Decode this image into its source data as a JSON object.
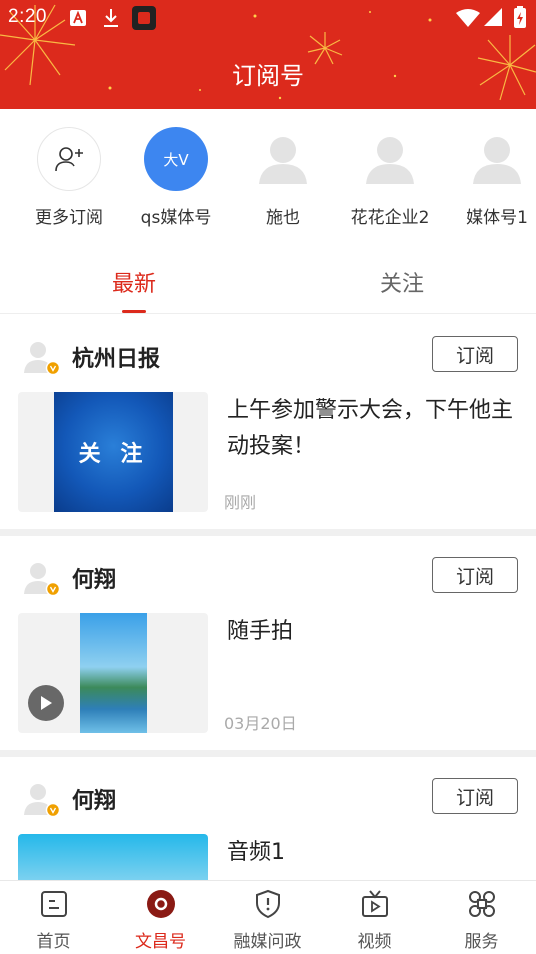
{
  "status_bar": {
    "time": "2:20"
  },
  "header": {
    "title": "订阅号"
  },
  "subscriptions": [
    {
      "label": "更多订阅",
      "type": "add"
    },
    {
      "label": "qs媒体号",
      "type": "badge",
      "badge_text": "大V",
      "color": "#3d86f0"
    },
    {
      "label": "施也",
      "type": "default"
    },
    {
      "label": "花花企业2",
      "type": "default"
    },
    {
      "label": "媒体号1",
      "type": "default"
    }
  ],
  "tabs": [
    {
      "label": "最新",
      "active": true
    },
    {
      "label": "关注",
      "active": false
    }
  ],
  "feed": [
    {
      "author": "杭州日报",
      "subscribe_label": "订阅",
      "title": "上午参加警示大会，下午他主动投案！",
      "date": "刚刚",
      "thumb_text": "关 注",
      "thumb_type": "image"
    },
    {
      "author": "何翔",
      "subscribe_label": "订阅",
      "title": "随手拍",
      "date": "03月20日",
      "thumb_type": "video"
    },
    {
      "author": "何翔",
      "subscribe_label": "订阅",
      "title": "音频1",
      "date": "",
      "thumb_type": "audio"
    }
  ],
  "bottom_nav": [
    {
      "label": "首页",
      "icon": "home-icon",
      "active": false
    },
    {
      "label": "文昌号",
      "icon": "wenchang-icon",
      "active": true
    },
    {
      "label": "融媒问政",
      "icon": "shield-icon",
      "active": false
    },
    {
      "label": "视频",
      "icon": "tv-icon",
      "active": false
    },
    {
      "label": "服务",
      "icon": "services-icon",
      "active": false
    }
  ],
  "colors": {
    "brand_red": "#dc2a1c",
    "verified_orange": "#f0a000",
    "badge_blue": "#3d86f0"
  }
}
